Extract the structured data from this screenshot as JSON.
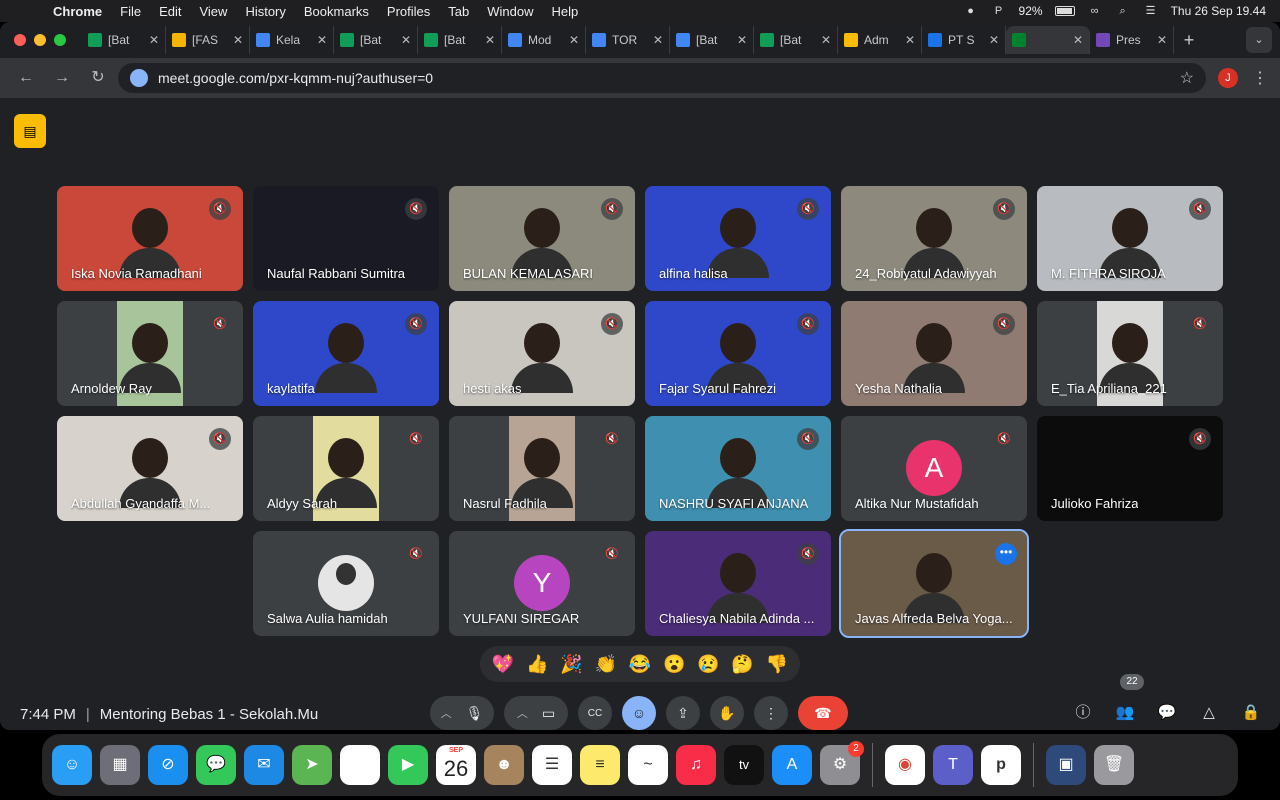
{
  "menubar": {
    "app_name": "Chrome",
    "menus": [
      "File",
      "Edit",
      "View",
      "History",
      "Bookmarks",
      "Profiles",
      "Tab",
      "Window",
      "Help"
    ],
    "battery": "92%",
    "datetime": "Thu 26 Sep  19.44"
  },
  "browser": {
    "tabs": [
      {
        "label": "[Bat",
        "icon": "sheets-icon",
        "color": "#0f9d58"
      },
      {
        "label": "[FAS",
        "icon": "slides-icon",
        "color": "#f4b400"
      },
      {
        "label": "Kela",
        "icon": "drive-icon",
        "color": "#4285f4"
      },
      {
        "label": "[Bat",
        "icon": "sheets-icon",
        "color": "#0f9d58"
      },
      {
        "label": "[Bat",
        "icon": "sheets-icon",
        "color": "#0f9d58"
      },
      {
        "label": "Mod",
        "icon": "drive-icon",
        "color": "#4285f4"
      },
      {
        "label": "TOR",
        "icon": "docs-icon",
        "color": "#4285f4"
      },
      {
        "label": "[Bat",
        "icon": "drive-icon",
        "color": "#4285f4"
      },
      {
        "label": "[Bat",
        "icon": "sheets-icon",
        "color": "#0f9d58"
      },
      {
        "label": "Adm",
        "icon": "site-icon",
        "color": "#fbbc04"
      },
      {
        "label": "PT S",
        "icon": "site-icon",
        "color": "#1a73e8"
      },
      {
        "label": "",
        "icon": "meet-icon",
        "color": "#00832d"
      },
      {
        "label": "Pres",
        "icon": "forms-icon",
        "color": "#7248b9"
      }
    ],
    "url": "meet.google.com/pxr-kqmm-nuj?authuser=0",
    "profile_initial": "J"
  },
  "meet": {
    "participants": [
      {
        "name": "Iska Novia Ramadhani",
        "bg": "#c9483a",
        "kind": "video"
      },
      {
        "name": "Naufal Rabbani Sumitra",
        "bg": "#1a1a24",
        "kind": "dark"
      },
      {
        "name": "BULAN KEMALASARI",
        "bg": "#8b8a7c",
        "kind": "video"
      },
      {
        "name": "alfina halisa",
        "bg": "#2f48c9",
        "kind": "video"
      },
      {
        "name": "24_Robiyatul Adawiyyah",
        "bg": "#8d8a7d",
        "kind": "video"
      },
      {
        "name": "M. FITHRA SIROJA",
        "bg": "#b8bcc0",
        "kind": "video"
      },
      {
        "name": "Arnoldew Ray",
        "bg": "#3c4043",
        "kind": "portrait",
        "portrait_bg": "#a8c49a"
      },
      {
        "name": "kaylatifa",
        "bg": "#2f48c9",
        "kind": "video"
      },
      {
        "name": "hesti akas",
        "bg": "#c9c6c0",
        "kind": "video"
      },
      {
        "name": "Fajar Syarul Fahrezi",
        "bg": "#2f48c9",
        "kind": "video"
      },
      {
        "name": "Yesha Nathalia",
        "bg": "#8f7b72",
        "kind": "video"
      },
      {
        "name": "E_Tia Apriliana_221",
        "bg": "#3c4043",
        "kind": "portrait",
        "portrait_bg": "#d8d8d6"
      },
      {
        "name": "Abdullah Gyandaffa M...",
        "bg": "#d7d3cc",
        "kind": "video"
      },
      {
        "name": "Aldyy Sarah",
        "bg": "#3c4043",
        "kind": "portrait",
        "portrait_bg": "#e2dc9e"
      },
      {
        "name": "Nasrul Fadhila",
        "bg": "#3c4043",
        "kind": "portrait",
        "portrait_bg": "#b7a494"
      },
      {
        "name": "NASHRU SYAFI ANJANA",
        "bg": "#3f8fb0",
        "kind": "video"
      },
      {
        "name": "Altika Nur Mustafidah",
        "bg": "#3c4043",
        "kind": "avatar",
        "initial": "A",
        "avatar_color": "#e8336d"
      },
      {
        "name": "Julioko Fahriza",
        "bg": "#0c0c0c",
        "kind": "dark"
      },
      {
        "name": "Salwa Aulia hamidah",
        "bg": "#3c4043",
        "kind": "photo-avatar",
        "avatar_color": "#e5e5e5"
      },
      {
        "name": "YULFANI SIREGAR",
        "bg": "#3c4043",
        "kind": "avatar",
        "initial": "Y",
        "avatar_color": "#b845c0"
      },
      {
        "name": "Chaliesya Nabila Adinda ...",
        "bg": "#4b2c78",
        "kind": "video"
      },
      {
        "name": "Javas Alfreda Belva Yoga...",
        "bg": "#6a5a48",
        "kind": "video",
        "selected": true
      }
    ],
    "reactions": [
      "💖",
      "👍",
      "🎉",
      "👏",
      "😂",
      "😮",
      "😢",
      "🤔",
      "👎"
    ],
    "time": "7:44 PM",
    "meeting_title": "Mentoring Bebas 1 - Sekolah.Mu",
    "people_count": "22"
  },
  "dock": {
    "calendar_month": "SEP",
    "calendar_day": "26",
    "settings_badge": "2",
    "apps": [
      "finder-icon",
      "launchpad-icon",
      "safari-icon",
      "messages-icon",
      "mail-icon",
      "maps-icon",
      "photos-icon",
      "facetime-icon",
      "calendar-icon",
      "contacts-icon",
      "reminders-icon",
      "notes-icon",
      "freeform-icon",
      "music-icon",
      "appletv-icon",
      "appstore-icon",
      "settings-icon",
      "chrome-icon",
      "teams-icon",
      "pcloud-icon",
      "preview-icon",
      "trash-icon"
    ]
  }
}
